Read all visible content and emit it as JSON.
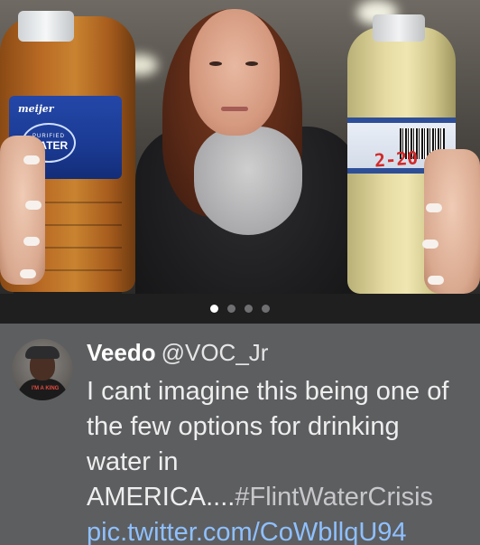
{
  "media": {
    "left_bottle": {
      "brand": "meijer",
      "label_top": "PURIFIED",
      "label_main": "WATER",
      "liquid_color": "#b86a24"
    },
    "right_bottle": {
      "handwritten": "2-20",
      "liquid_color": "#e6dba2"
    },
    "pager": {
      "count": 4,
      "active_index": 0
    }
  },
  "tweet": {
    "display_name": "Veedo",
    "handle": "@VOC_Jr",
    "text": "I cant imagine this being one of the few options for drinking water in AMERICA....",
    "hashtag": "#FlintWaterCrisis",
    "link": "pic.twitter.com/CoWbllqU94",
    "avatar_shirt_text": "I'M A KING"
  },
  "colors": {
    "background": "#5d5e60",
    "link": "#8ec0ff",
    "pager_active": "#ffffff",
    "pager_inactive": "#6f6f72"
  }
}
